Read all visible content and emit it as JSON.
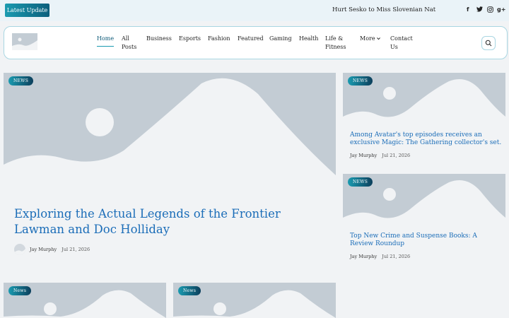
{
  "topbar": {
    "latest_label": "Latest Update",
    "ticker_text": "Hurt Sesko to Miss Slovenian Nat",
    "social": [
      {
        "icon": "facebook-icon",
        "glyph": "f"
      },
      {
        "icon": "twitter-icon",
        "glyph": "🐦"
      },
      {
        "icon": "instagram-icon",
        "glyph": "◎"
      },
      {
        "icon": "google-plus-icon",
        "glyph": "g+"
      }
    ]
  },
  "nav": {
    "items": [
      {
        "label": "Home"
      },
      {
        "label": "All Posts"
      },
      {
        "label": "Business"
      },
      {
        "label": "Esports"
      },
      {
        "label": "Fashion"
      },
      {
        "label": "Featured"
      },
      {
        "label": "Gaming"
      },
      {
        "label": "Health"
      },
      {
        "label": "Life & Fitness"
      },
      {
        "label": "More"
      },
      {
        "label": "Contact Us"
      }
    ]
  },
  "featured": {
    "badge": "NEWS",
    "title": "Exploring the Actual Legends of the Frontier Lawman and Doc Holliday",
    "author": "Jay Murphy",
    "date": "Jul 21, 2026"
  },
  "side_posts": [
    {
      "badge": "NEWS",
      "title": "Among Avatar's top episodes receives an exclusive Magic: The Gathering collector's set.",
      "author": "Jay Murphy",
      "date": "Jul 21, 2026"
    },
    {
      "badge": "NEWS",
      "title": "Top New Crime and Suspense Books: A Review Roundup",
      "author": "Jay Murphy",
      "date": "Jul 21, 2026"
    }
  ],
  "bottom_posts": [
    {
      "badge": "News"
    },
    {
      "badge": "News"
    }
  ],
  "colors": {
    "accent": "#1a9bb0",
    "accent_dark": "#0c5f7c",
    "title_blue": "#1b6db8",
    "placeholder": "#c3ccd4",
    "placeholder_shape": "#f1f3f5"
  }
}
